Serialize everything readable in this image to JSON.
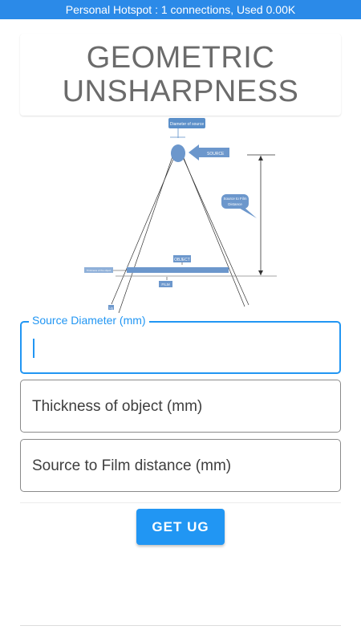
{
  "status_bar": {
    "text": "Personal Hotspot : 1 connections, Used 0.00K",
    "color": "#2b8ae8"
  },
  "title": {
    "line1": "GEOMETRIC",
    "line2": "UNSHARPNESS"
  },
  "diagram": {
    "diameter_label": "Diameter of source",
    "source_label": "SOURCE",
    "sfd_label_line1": "Source to Film",
    "sfd_label_line2": "Distance",
    "object_label": "OBJECT",
    "thickness_label": "Thickness of the object",
    "film_label": "FILM",
    "ug_label": "Ug"
  },
  "form": {
    "source_diameter": {
      "label": "Source Diameter (mm)",
      "value": ""
    },
    "thickness": {
      "placeholder": "Thickness of object (mm)",
      "value": ""
    },
    "sfd": {
      "placeholder": "Source to Film distance (mm)",
      "value": ""
    }
  },
  "button": {
    "label": "GET UG",
    "color": "#2196f3"
  }
}
